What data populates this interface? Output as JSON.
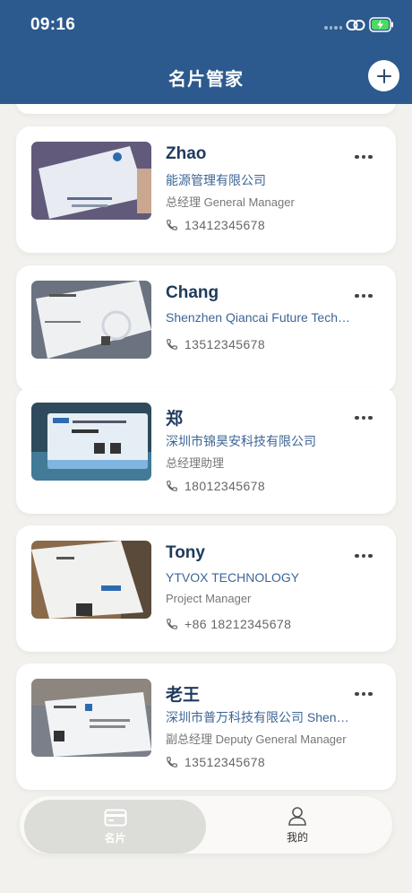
{
  "status_bar": {
    "time": "09:16"
  },
  "header": {
    "title": "名片管家"
  },
  "cards": [
    {
      "name": "Zhao",
      "company": "能源管理有限公司",
      "position": "总经理 General Manager",
      "phone": "13412345678"
    },
    {
      "name": "Chang",
      "company": "Shenzhen Qiancai Future Technology",
      "position": "",
      "phone": "13512345678"
    },
    {
      "name": "郑",
      "company": "深圳市锦昊安科技有限公司",
      "position": "总经理助理",
      "phone": "18012345678"
    },
    {
      "name": "Tony",
      "company": "YTVOX TECHNOLOGY",
      "position": "Project Manager",
      "phone": "+86 18212345678"
    },
    {
      "name": "老王",
      "company": "深圳市普万科技有限公司 Shenzhen Puwan Technology",
      "position": "副总经理 Deputy General Manager",
      "phone": "13512345678"
    }
  ],
  "tabbar": {
    "items": [
      {
        "label": "名片",
        "icon": "card-icon",
        "active": true
      },
      {
        "label": "我的",
        "icon": "person-icon",
        "active": false
      }
    ]
  },
  "colors": {
    "header": "#2d5a8e",
    "name": "#1f3a5c",
    "company": "#3d6596",
    "background": "#f2f1ee"
  }
}
